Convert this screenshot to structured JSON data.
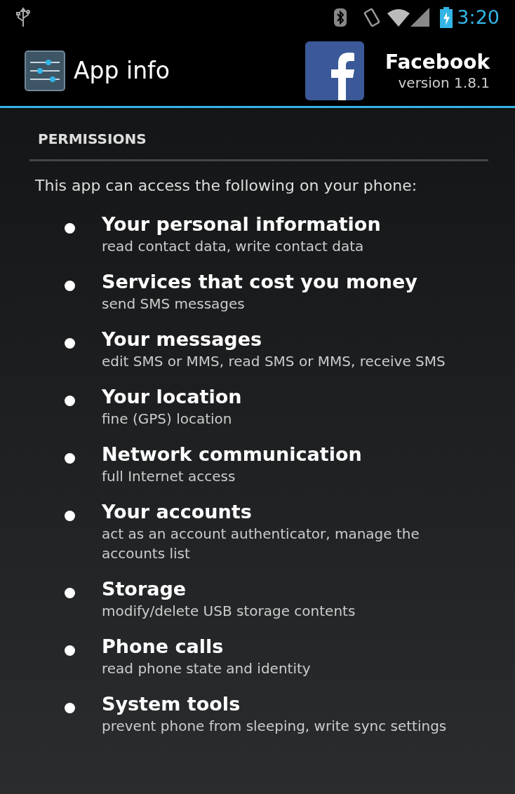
{
  "status_bar": {
    "time": "3:20"
  },
  "action_bar": {
    "title": "App info",
    "app_name": "Facebook",
    "app_version": "version 1.8.1"
  },
  "section": {
    "header": "PERMISSIONS",
    "intro": "This app can access the following on your phone:"
  },
  "permissions": [
    {
      "title": "Your personal information",
      "detail": "read contact data, write contact data"
    },
    {
      "title": "Services that cost you money",
      "detail": "send SMS messages"
    },
    {
      "title": "Your messages",
      "detail": "edit SMS or MMS, read SMS or MMS, receive SMS"
    },
    {
      "title": "Your location",
      "detail": "fine (GPS) location"
    },
    {
      "title": "Network communication",
      "detail": "full Internet access"
    },
    {
      "title": "Your accounts",
      "detail": "act as an account authenticator, manage the accounts list"
    },
    {
      "title": "Storage",
      "detail": "modify/delete USB storage contents"
    },
    {
      "title": "Phone calls",
      "detail": "read phone state and identity"
    },
    {
      "title": "System tools",
      "detail": "prevent phone from sleeping, write sync settings"
    }
  ]
}
